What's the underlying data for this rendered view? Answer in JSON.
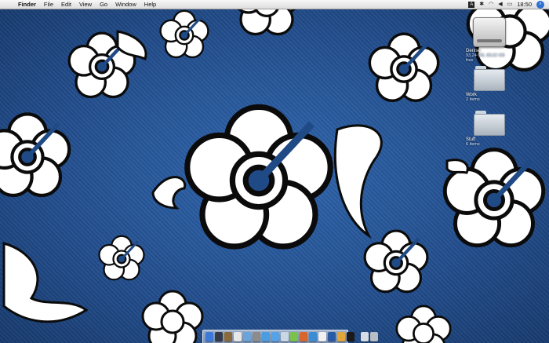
{
  "menubar": {
    "app_name": "Finder",
    "menus": [
      "File",
      "Edit",
      "View",
      "Go",
      "Window",
      "Help"
    ],
    "keyboard_layout": "A",
    "clock": "18:50"
  },
  "desktop_icons": [
    {
      "label": "Denise",
      "sub": "93,24 GB, 88,62 GB free",
      "kind": "hard-drive"
    },
    {
      "label": "Work",
      "sub": "2 items",
      "kind": "folder"
    },
    {
      "label": "Stuff",
      "sub": "6 items",
      "kind": "folder"
    }
  ],
  "dock": {
    "apps": [
      {
        "name": "finder",
        "color": "#3b7ad9"
      },
      {
        "name": "dashboard",
        "color": "#333b4a"
      },
      {
        "name": "address-book",
        "color": "#8a6a3a"
      },
      {
        "name": "ical",
        "color": "#e8e8e8"
      },
      {
        "name": "iphoto",
        "color": "#6aa4d8"
      },
      {
        "name": "system-preferences",
        "color": "#8c8c8c"
      },
      {
        "name": "itunes",
        "color": "#4a9de0"
      },
      {
        "name": "safari",
        "color": "#55a2e6"
      },
      {
        "name": "mail",
        "color": "#c9d6e3"
      },
      {
        "name": "ichat",
        "color": "#7bc24a"
      },
      {
        "name": "firefox",
        "color": "#d9662a"
      },
      {
        "name": "preview",
        "color": "#3c8cd4"
      },
      {
        "name": "textedit",
        "color": "#f0f0f0"
      },
      {
        "name": "photoshop",
        "color": "#2b5aa5"
      },
      {
        "name": "garageband",
        "color": "#e0a53b"
      },
      {
        "name": "terminal",
        "color": "#1a1a1a"
      }
    ],
    "others": [
      {
        "name": "documents-stack",
        "color": "#d6dce4"
      },
      {
        "name": "trash",
        "color": "#b8bec6"
      }
    ]
  }
}
